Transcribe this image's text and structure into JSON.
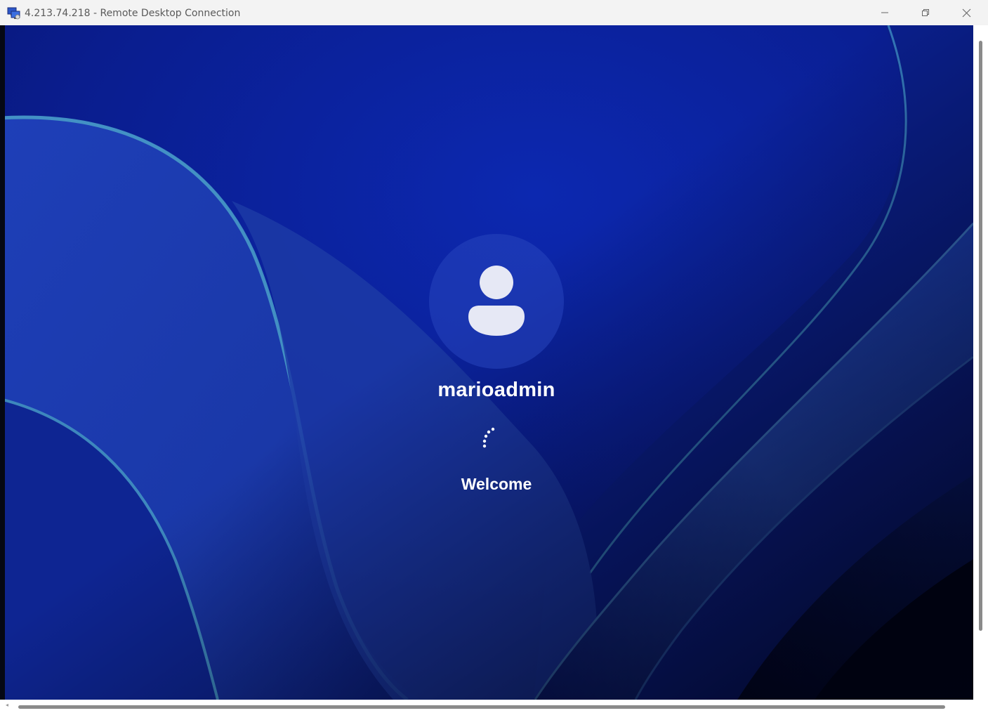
{
  "window": {
    "title": "4.213.74.218 - Remote Desktop Connection",
    "icon": "remote-desktop-icon",
    "controls": {
      "minimize_icon": "minimize-icon",
      "restore_icon": "restore-icon",
      "close_icon": "close-icon"
    }
  },
  "login": {
    "username": "marioadmin",
    "status": "Welcome",
    "avatar_icon": "user-avatar-icon",
    "spinner_icon": "loading-spinner-icon"
  },
  "colors": {
    "wallpaper_base": "#0a1e8a",
    "wallpaper_dark": "#030a3a",
    "ribbon_highlight": "#4aa0c8",
    "text": "#ffffff",
    "titlebar": "#f3f3f3"
  }
}
